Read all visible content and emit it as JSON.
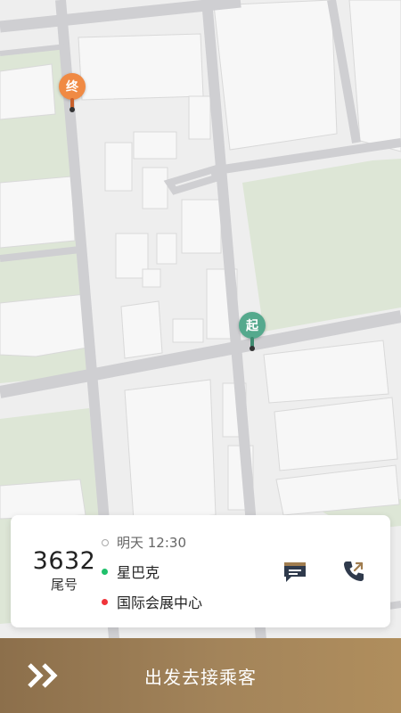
{
  "map": {
    "end_marker": "终",
    "start_marker": "起",
    "colors": {
      "road": "#cfcfd2",
      "building": "#f6f6f6",
      "park": "#dde6d6",
      "ground": "#eeeeee"
    }
  },
  "order": {
    "plate_tail": "3632",
    "plate_caption": "尾号",
    "time": "明天 12:30",
    "from": "星巴克",
    "to": "国际会展中心"
  },
  "actions": {
    "message_icon": "message-icon",
    "phone_icon": "phone-icon"
  },
  "bottom_bar": {
    "label": "出发去接乘客",
    "icon": "double-chevron-right-icon"
  }
}
